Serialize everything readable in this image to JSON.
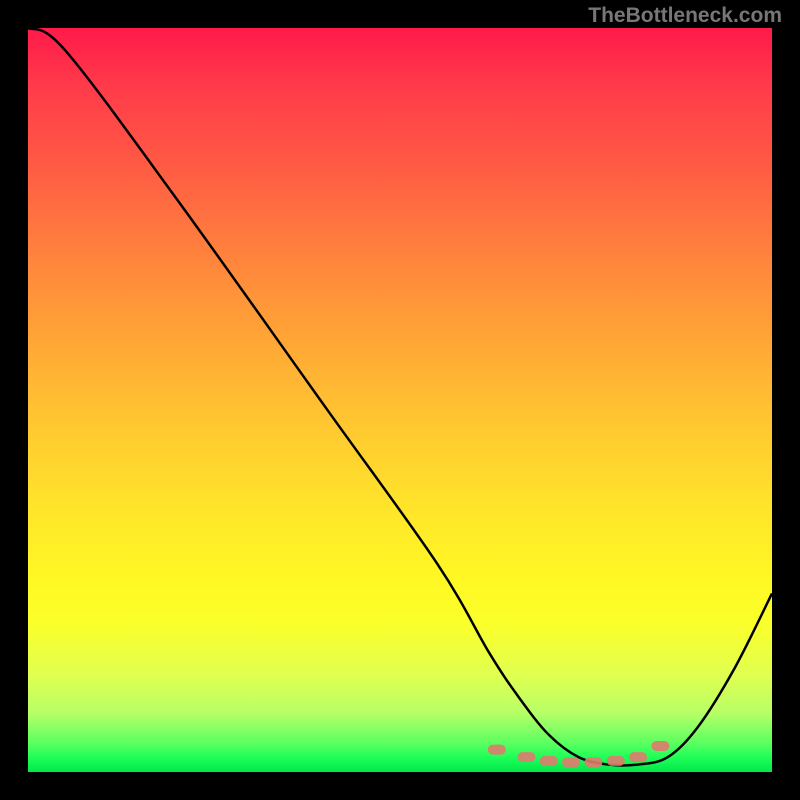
{
  "watermark": "TheBottleneck.com",
  "chart_data": {
    "type": "line",
    "title": "",
    "xlabel": "",
    "ylabel": "",
    "xlim": [
      0,
      100
    ],
    "ylim": [
      0,
      100
    ],
    "series": [
      {
        "name": "curve",
        "x": [
          0,
          5,
          20,
          40,
          55,
          62,
          66,
          70,
          74,
          78,
          82,
          86,
          90,
          95,
          100
        ],
        "values": [
          100,
          97,
          77,
          49,
          28,
          16,
          10,
          5,
          2,
          1,
          1,
          2,
          6,
          14,
          24
        ]
      },
      {
        "name": "optimal-markers",
        "x": [
          63,
          67,
          70,
          73,
          76,
          79,
          82,
          85
        ],
        "values": [
          3,
          2,
          1.5,
          1.3,
          1.3,
          1.5,
          2,
          3.5
        ]
      }
    ],
    "colors": {
      "curve": "#000000",
      "markers": "#e07a6f",
      "gradient_top": "#ff1a4a",
      "gradient_bottom": "#00e84a"
    }
  }
}
